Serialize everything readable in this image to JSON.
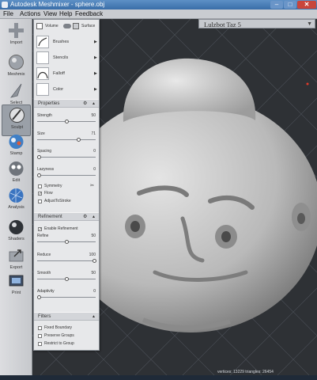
{
  "window": {
    "title": "Autodesk Meshmixer - sphere.obj",
    "minimize": "–",
    "maximize": "□",
    "close": "✕"
  },
  "menu": [
    "File",
    "Actions",
    "View",
    "Help",
    "Feedback"
  ],
  "toolbar": [
    {
      "label": "Import",
      "icon": "plus-icon"
    },
    {
      "label": "Meshmix",
      "icon": "meshmix-icon"
    },
    {
      "label": "Select",
      "icon": "select-icon"
    },
    {
      "label": "Sculpt",
      "icon": "sculpt-icon",
      "active": true
    },
    {
      "label": "Stamp",
      "icon": "stamp-icon"
    },
    {
      "label": "Edit",
      "icon": "edit-icon"
    },
    {
      "label": "Analysis",
      "icon": "analysis-icon"
    },
    {
      "label": "Shaders",
      "icon": "shaders-icon"
    },
    {
      "label": "Export",
      "icon": "export-icon"
    },
    {
      "label": "Print",
      "icon": "print-icon"
    }
  ],
  "viewport": {
    "printer": "Lulzbot Taz 5",
    "status": "vertices: 13229  triangles: 26454",
    "background": "#2e3135"
  },
  "panel": {
    "mode": {
      "volume": "Volume",
      "surface": "Surface"
    },
    "tools": [
      "Brushes",
      "Stencils",
      "Falloff",
      "Color"
    ],
    "properties": {
      "title": "Properties",
      "sliders": [
        {
          "label": "Strength",
          "value": "50",
          "pos": 0.5
        },
        {
          "label": "Size",
          "value": "71",
          "pos": 0.71
        },
        {
          "label": "Spacing",
          "value": "0",
          "pos": 0.0
        },
        {
          "label": "Lazyness",
          "value": "0",
          "pos": 0.0
        }
      ],
      "checks": [
        {
          "label": "Symmetry",
          "checked": false
        },
        {
          "label": "Flow",
          "checked": true
        },
        {
          "label": "AdjustToStroke",
          "checked": false
        }
      ]
    },
    "refinement": {
      "title": "Refinement",
      "enable": {
        "label": "Enable Refinement",
        "checked": true
      },
      "sliders": [
        {
          "label": "Refine",
          "value": "50",
          "pos": 0.5
        },
        {
          "label": "Reduce",
          "value": "100",
          "pos": 1.0
        },
        {
          "label": "Smooth",
          "value": "50",
          "pos": 0.5
        },
        {
          "label": "Adaptivity",
          "value": "0",
          "pos": 0.0
        }
      ]
    },
    "filters": {
      "title": "Filters",
      "checks": [
        {
          "label": "Fixed Boundary",
          "checked": false
        },
        {
          "label": "Preserve Groups",
          "checked": false
        },
        {
          "label": "Restrict to Group",
          "checked": false
        }
      ]
    }
  }
}
